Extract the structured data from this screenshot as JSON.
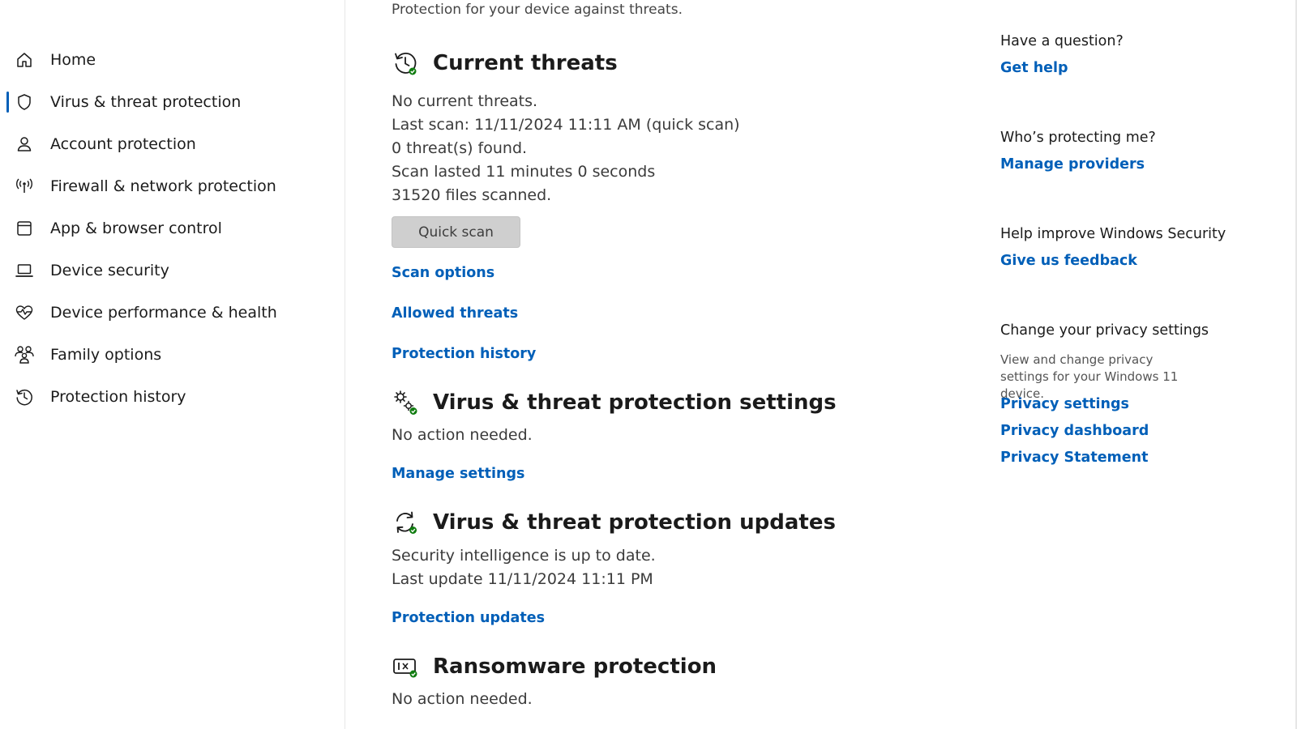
{
  "sidebar": {
    "items": [
      {
        "label": "Home",
        "icon": "home-icon",
        "active": false
      },
      {
        "label": "Virus & threat protection",
        "icon": "shield-icon",
        "active": true
      },
      {
        "label": "Account protection",
        "icon": "person-icon",
        "active": false
      },
      {
        "label": "Firewall & network protection",
        "icon": "antenna-icon",
        "active": false
      },
      {
        "label": "App & browser control",
        "icon": "app-window-icon",
        "active": false
      },
      {
        "label": "Device security",
        "icon": "laptop-icon",
        "active": false
      },
      {
        "label": "Device performance & health",
        "icon": "heart-pulse-icon",
        "active": false
      },
      {
        "label": "Family options",
        "icon": "family-icon",
        "active": false
      },
      {
        "label": "Protection history",
        "icon": "history-icon",
        "active": false
      }
    ]
  },
  "main": {
    "subtitle": "Protection for your device against threats.",
    "current_threats": {
      "title": "Current threats",
      "icon": "clock-check-icon",
      "lines": [
        "No current threats.",
        "Last scan: 11/11/2024 11:11 AM (quick scan)",
        "0 threat(s) found.",
        "Scan lasted 11 minutes 0 seconds",
        "31520 files scanned."
      ],
      "quick_scan_label": "Quick scan",
      "links": [
        "Scan options",
        "Allowed threats",
        "Protection history"
      ]
    },
    "settings": {
      "title": "Virus & threat protection settings",
      "icon": "gears-check-icon",
      "status": "No action needed.",
      "link": "Manage settings"
    },
    "updates": {
      "title": "Virus & threat protection updates",
      "icon": "refresh-check-icon",
      "lines": [
        "Security intelligence is up to date.",
        "Last update 11/11/2024 11:11 PM"
      ],
      "link": "Protection updates"
    },
    "ransomware": {
      "title": "Ransomware protection",
      "icon": "ransomware-check-icon",
      "status": "No action needed."
    }
  },
  "aside": {
    "question": {
      "heading": "Have a question?",
      "link": "Get help"
    },
    "protecting": {
      "heading": "Who’s protecting me?",
      "link": "Manage providers"
    },
    "improve": {
      "heading": "Help improve Windows Security",
      "link": "Give us feedback"
    },
    "privacy": {
      "heading": "Change your privacy settings",
      "description": "View and change privacy settings for your Windows 11 device.",
      "links": [
        "Privacy settings",
        "Privacy dashboard",
        "Privacy Statement"
      ]
    }
  },
  "colors": {
    "accent": "#005fb8",
    "check_green": "#107c10",
    "button_bg": "#cfcfcf"
  }
}
